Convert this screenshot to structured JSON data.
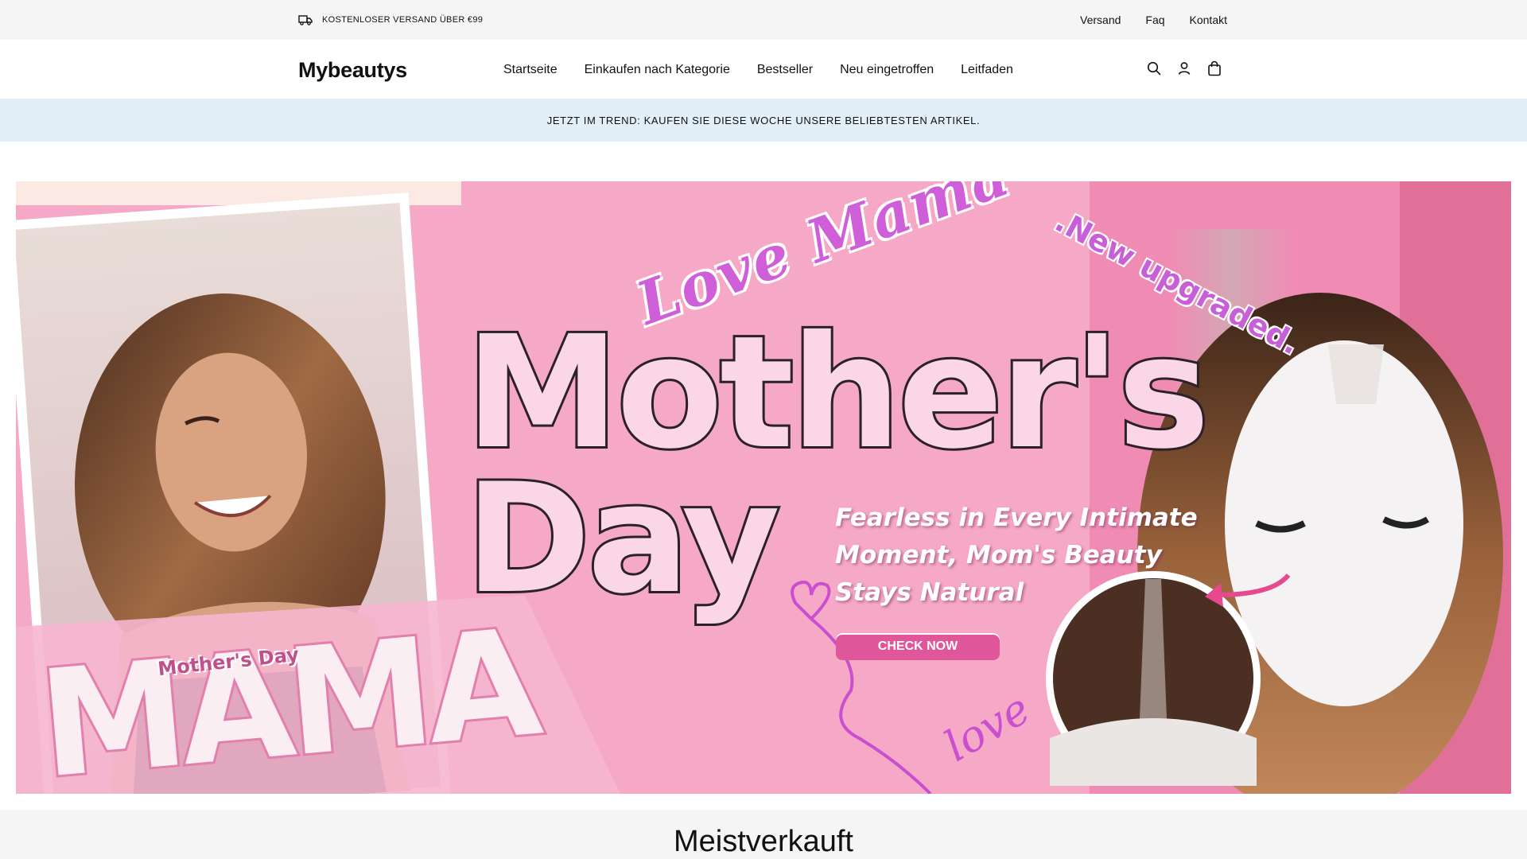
{
  "topbar": {
    "shipping_text": "KOSTENLOSER VERSAND ÜBER €99",
    "links": [
      "Versand",
      "Faq",
      "Kontakt"
    ]
  },
  "header": {
    "logo": "Mybeautys",
    "nav": [
      "Startseite",
      "Einkaufen nach Kategorie",
      "Bestseller",
      "Neu eingetroffen",
      "Leitfaden"
    ],
    "icons": [
      "search-icon",
      "account-icon",
      "cart-icon"
    ]
  },
  "trend_bar": {
    "text": "JETZT IM TREND: KAUFEN SIE DIESE WOCHE UNSERE BELIEBTESTEN ARTIKEL."
  },
  "hero": {
    "script_heading": "Love Mama",
    "subheading": ".New upgraded.",
    "title_line1": "Mother's",
    "title_line2": "Day",
    "tagline_1": "Fearless in Every Intimate",
    "tagline_2": "Moment, Mom's Beauty",
    "tagline_3": "Stays Natural",
    "cta": "CHECK NOW",
    "badge_small": "Mother's Day",
    "badge_big": "MAMA",
    "love_script": "love"
  },
  "section": {
    "title": "Meistverkauft"
  },
  "colors": {
    "topbar_bg": "#f5f5f5",
    "trendbar_bg": "#e2eff9",
    "hero_pink": "#f39ac0",
    "cta_pink": "#e0569a"
  }
}
